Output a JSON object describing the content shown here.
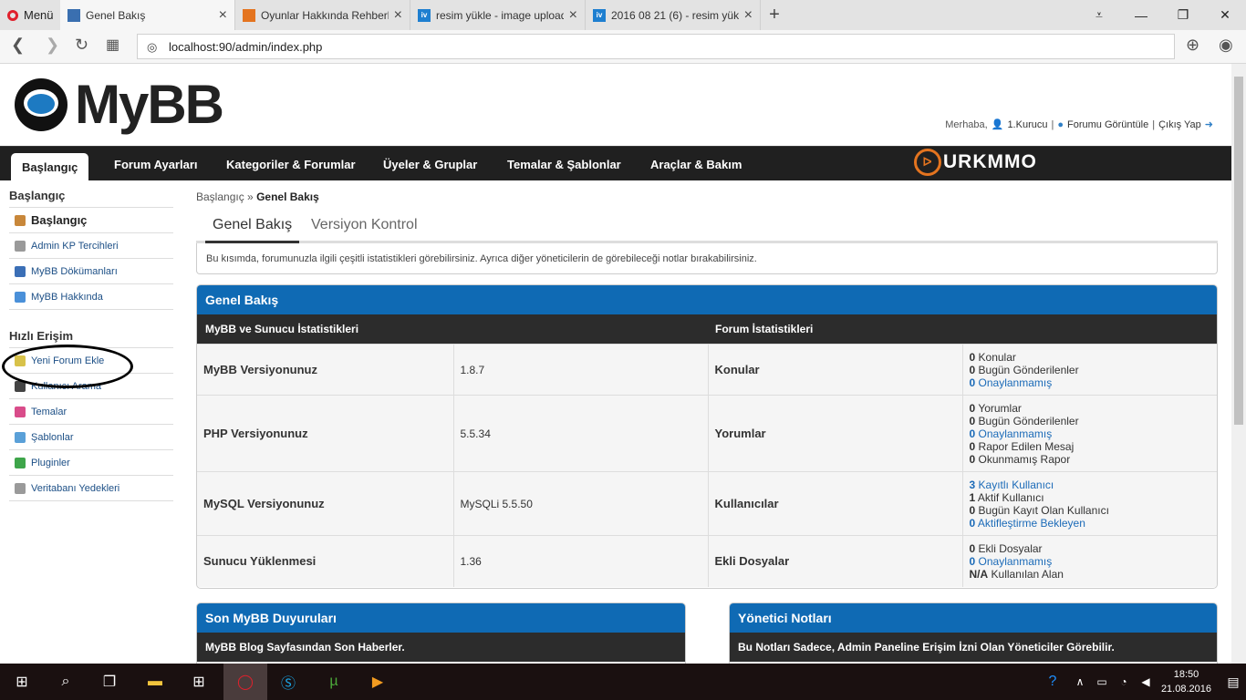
{
  "browser": {
    "menu_label": "Menü",
    "tabs": [
      {
        "title": "Genel Bakış",
        "fav_color": "#3a6fb0",
        "fav_text": ""
      },
      {
        "title": "Oyunlar Hakkında Rehberle",
        "fav_color": "#e4741f",
        "fav_text": ""
      },
      {
        "title": "resim yükle - image upload",
        "fav_color": "#1e7fd0",
        "fav_text": "iv"
      },
      {
        "title": "2016 08 21 (6) - resim yükl",
        "fav_color": "#1e7fd0",
        "fav_text": "iv"
      }
    ],
    "url": "localhost:90/admin/index.php"
  },
  "header": {
    "logo_text": "MyBB",
    "welcome": "Merhaba,",
    "user": "1.Kurucu",
    "view_forum": "Forumu Görüntüle",
    "logout": "Çıkış Yap"
  },
  "nav": {
    "items": [
      "Başlangıç",
      "Forum Ayarları",
      "Kategoriler & Forumlar",
      "Üyeler & Gruplar",
      "Temalar & Şablonlar",
      "Araçlar & Bakım"
    ],
    "brand": "URKMMO"
  },
  "sidebar": {
    "section1_title": "Başlangıç",
    "items1": [
      {
        "label": "Başlangıç",
        "icon": "home-icon",
        "color": "#c8873a"
      },
      {
        "label": "Admin KP Tercihleri",
        "icon": "gear-icon",
        "color": "#9a9a9a"
      },
      {
        "label": "MyBB Dökümanları",
        "icon": "book-icon",
        "color": "#3b6fb6"
      },
      {
        "label": "MyBB Hakkında",
        "icon": "cube-icon",
        "color": "#4a90d9"
      }
    ],
    "section2_title": "Hızlı Erişim",
    "items2": [
      {
        "label": "Yeni Forum Ekle",
        "icon": "folder-add-icon",
        "color": "#d8c24a"
      },
      {
        "label": "Kullanıcı Arama",
        "icon": "binoculars-icon",
        "color": "#444444"
      },
      {
        "label": "Temalar",
        "icon": "palette-icon",
        "color": "#d94c8a"
      },
      {
        "label": "Şablonlar",
        "icon": "template-icon",
        "color": "#5aa0d8"
      },
      {
        "label": "Pluginler",
        "icon": "puzzle-icon",
        "color": "#3ea54a"
      },
      {
        "label": "Veritabanı Yedekleri",
        "icon": "gear-icon",
        "color": "#9a9a9a"
      }
    ]
  },
  "content": {
    "breadcrumb_home": "Başlangıç",
    "breadcrumb_sep": "»",
    "breadcrumb_current": "Genel Bakış",
    "tab_overview": "Genel Bakış",
    "tab_version": "Versiyon Kontrol",
    "intro": "Bu kısımda, forumunuzla ilgili çeşitli istatistikleri görebilirsiniz. Ayrıca diğer yöneticilerin de görebileceği notlar bırakabilirsiniz."
  },
  "overview": {
    "title": "Genel Bakış",
    "col1": "MyBB ve Sunucu İstatistikleri",
    "col2": "Forum İstatistikleri",
    "rows": [
      {
        "label": "MyBB Versiyonunuz",
        "value": "1.8.7",
        "flabel": "Konular",
        "lines": [
          {
            "n": "0",
            "t": "Konular",
            "link": false
          },
          {
            "n": "0",
            "t": "Bugün Gönderilenler",
            "link": false
          },
          {
            "n": "0",
            "t": "Onaylanmamış",
            "link": true
          }
        ]
      },
      {
        "label": "PHP Versiyonunuz",
        "value": "5.5.34",
        "flabel": "Yorumlar",
        "lines": [
          {
            "n": "0",
            "t": "Yorumlar",
            "link": false
          },
          {
            "n": "0",
            "t": "Bugün Gönderilenler",
            "link": false
          },
          {
            "n": "0",
            "t": "Onaylanmamış",
            "link": true
          },
          {
            "n": "0",
            "t": "Rapor Edilen Mesaj",
            "link": false
          },
          {
            "n": "0",
            "t": "Okunmamış Rapor",
            "link": false
          }
        ]
      },
      {
        "label": "MySQL Versiyonunuz",
        "value": "MySQLi 5.5.50",
        "flabel": "Kullanıcılar",
        "lines": [
          {
            "n": "3",
            "t": "Kayıtlı Kullanıcı",
            "link": true
          },
          {
            "n": "1",
            "t": "Aktif Kullanıcı",
            "link": false
          },
          {
            "n": "0",
            "t": "Bugün Kayıt Olan Kullanıcı",
            "link": false
          },
          {
            "n": "0",
            "t": "Aktifleştirme Bekleyen",
            "link": true
          }
        ]
      },
      {
        "label": "Sunucu Yüklenmesi",
        "value": "1.36",
        "flabel": "Ekli Dosyalar",
        "lines": [
          {
            "n": "0",
            "t": "Ekli Dosyalar",
            "link": false
          },
          {
            "n": "0",
            "t": "Onaylanmamış",
            "link": true
          },
          {
            "n": "N/A",
            "t": "Kullanılan Alan",
            "link": false
          }
        ]
      }
    ]
  },
  "news": {
    "title": "Son MyBB Duyuruları",
    "subtitle": "MyBB Blog Sayfasından Son Haberler."
  },
  "notes": {
    "title": "Yönetici Notları",
    "subtitle": "Bu Notları Sadece, Admin Paneline Erişim İzni Olan Yöneticiler Görebilir."
  },
  "taskbar": {
    "time": "18:50",
    "date": "21.08.2016"
  }
}
